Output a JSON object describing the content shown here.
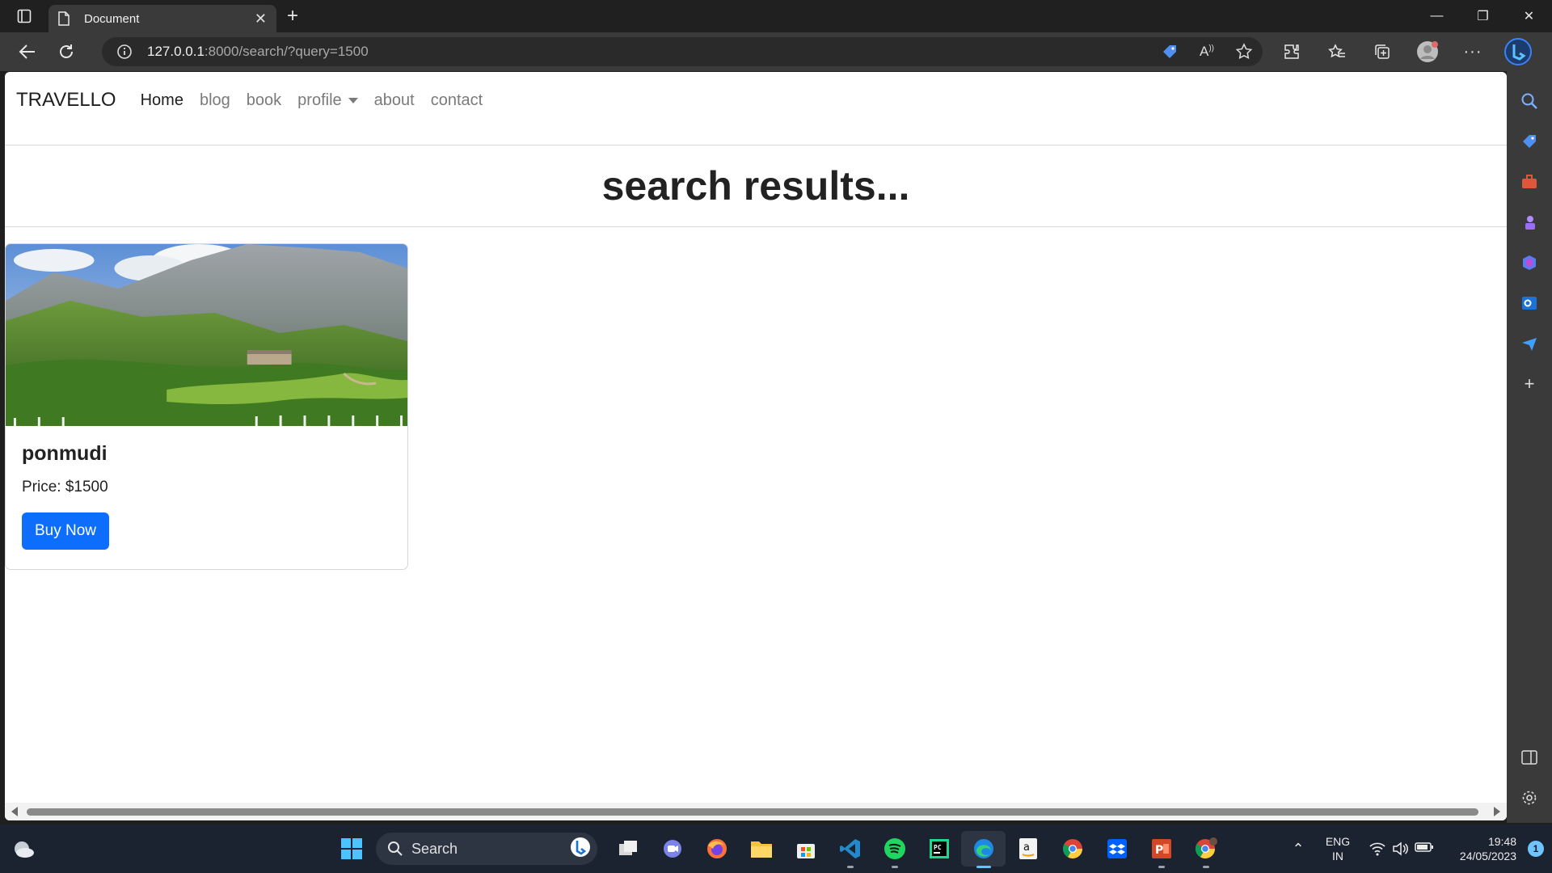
{
  "browser": {
    "tab_title": "Document",
    "url_host": "127.0.0.1",
    "url_rest": ":8000/search/?query=1500"
  },
  "page": {
    "brand": "TRAVELLO",
    "nav": [
      {
        "label": "Home"
      },
      {
        "label": "blog"
      },
      {
        "label": "book"
      },
      {
        "label": "profile"
      },
      {
        "label": "about"
      },
      {
        "label": "contact"
      }
    ],
    "heading": "search results...",
    "results": [
      {
        "title": "ponmudi",
        "price": "Price: $1500",
        "button": "Buy Now"
      }
    ]
  },
  "taskbar": {
    "search_placeholder": "Search",
    "lang_1": "ENG",
    "lang_2": "IN",
    "time": "19:48",
    "date": "24/05/2023",
    "notifications": "1"
  },
  "colors": {
    "primary_button": "#0d6efd",
    "taskbar_bg": "#1c2330",
    "chrome_bg": "#3a3a3a"
  }
}
